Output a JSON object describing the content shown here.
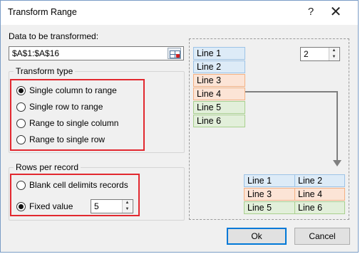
{
  "dialog": {
    "title": "Transform Range",
    "help_glyph": "?",
    "close_glyph": "✕"
  },
  "data_section": {
    "label": "Data to be transformed:",
    "range_value": "$A$1:$A$16",
    "select_icon": "range-select-icon"
  },
  "transform_type": {
    "title": "Transform type",
    "options": [
      {
        "label": "Single column to range",
        "checked": true
      },
      {
        "label": "Single row to range",
        "checked": false
      },
      {
        "label": "Range to single column",
        "checked": false
      },
      {
        "label": "Range to single row",
        "checked": false
      }
    ]
  },
  "rows_per_record": {
    "title": "Rows per record",
    "blank_cell_label": "Blank cell delimits records",
    "fixed_value_label": "Fixed value",
    "fixed_value": "5",
    "selected": "fixed_value"
  },
  "preview": {
    "columns_value": "2",
    "source_cells": [
      "Line 1",
      "Line 2",
      "Line 3",
      "Line 4",
      "Line 5",
      "Line 6"
    ],
    "result_cells": [
      [
        "Line 1",
        "Line 2"
      ],
      [
        "Line 3",
        "Line 4"
      ],
      [
        "Line 5",
        "Line 6"
      ]
    ]
  },
  "buttons": {
    "ok": "Ok",
    "cancel": "Cancel"
  },
  "colors": {
    "highlight_border": "#e2282f",
    "cell_blue": "#ddebf7",
    "cell_peach": "#fce4d6",
    "cell_green": "#e2efda",
    "accent": "#0078d7"
  }
}
